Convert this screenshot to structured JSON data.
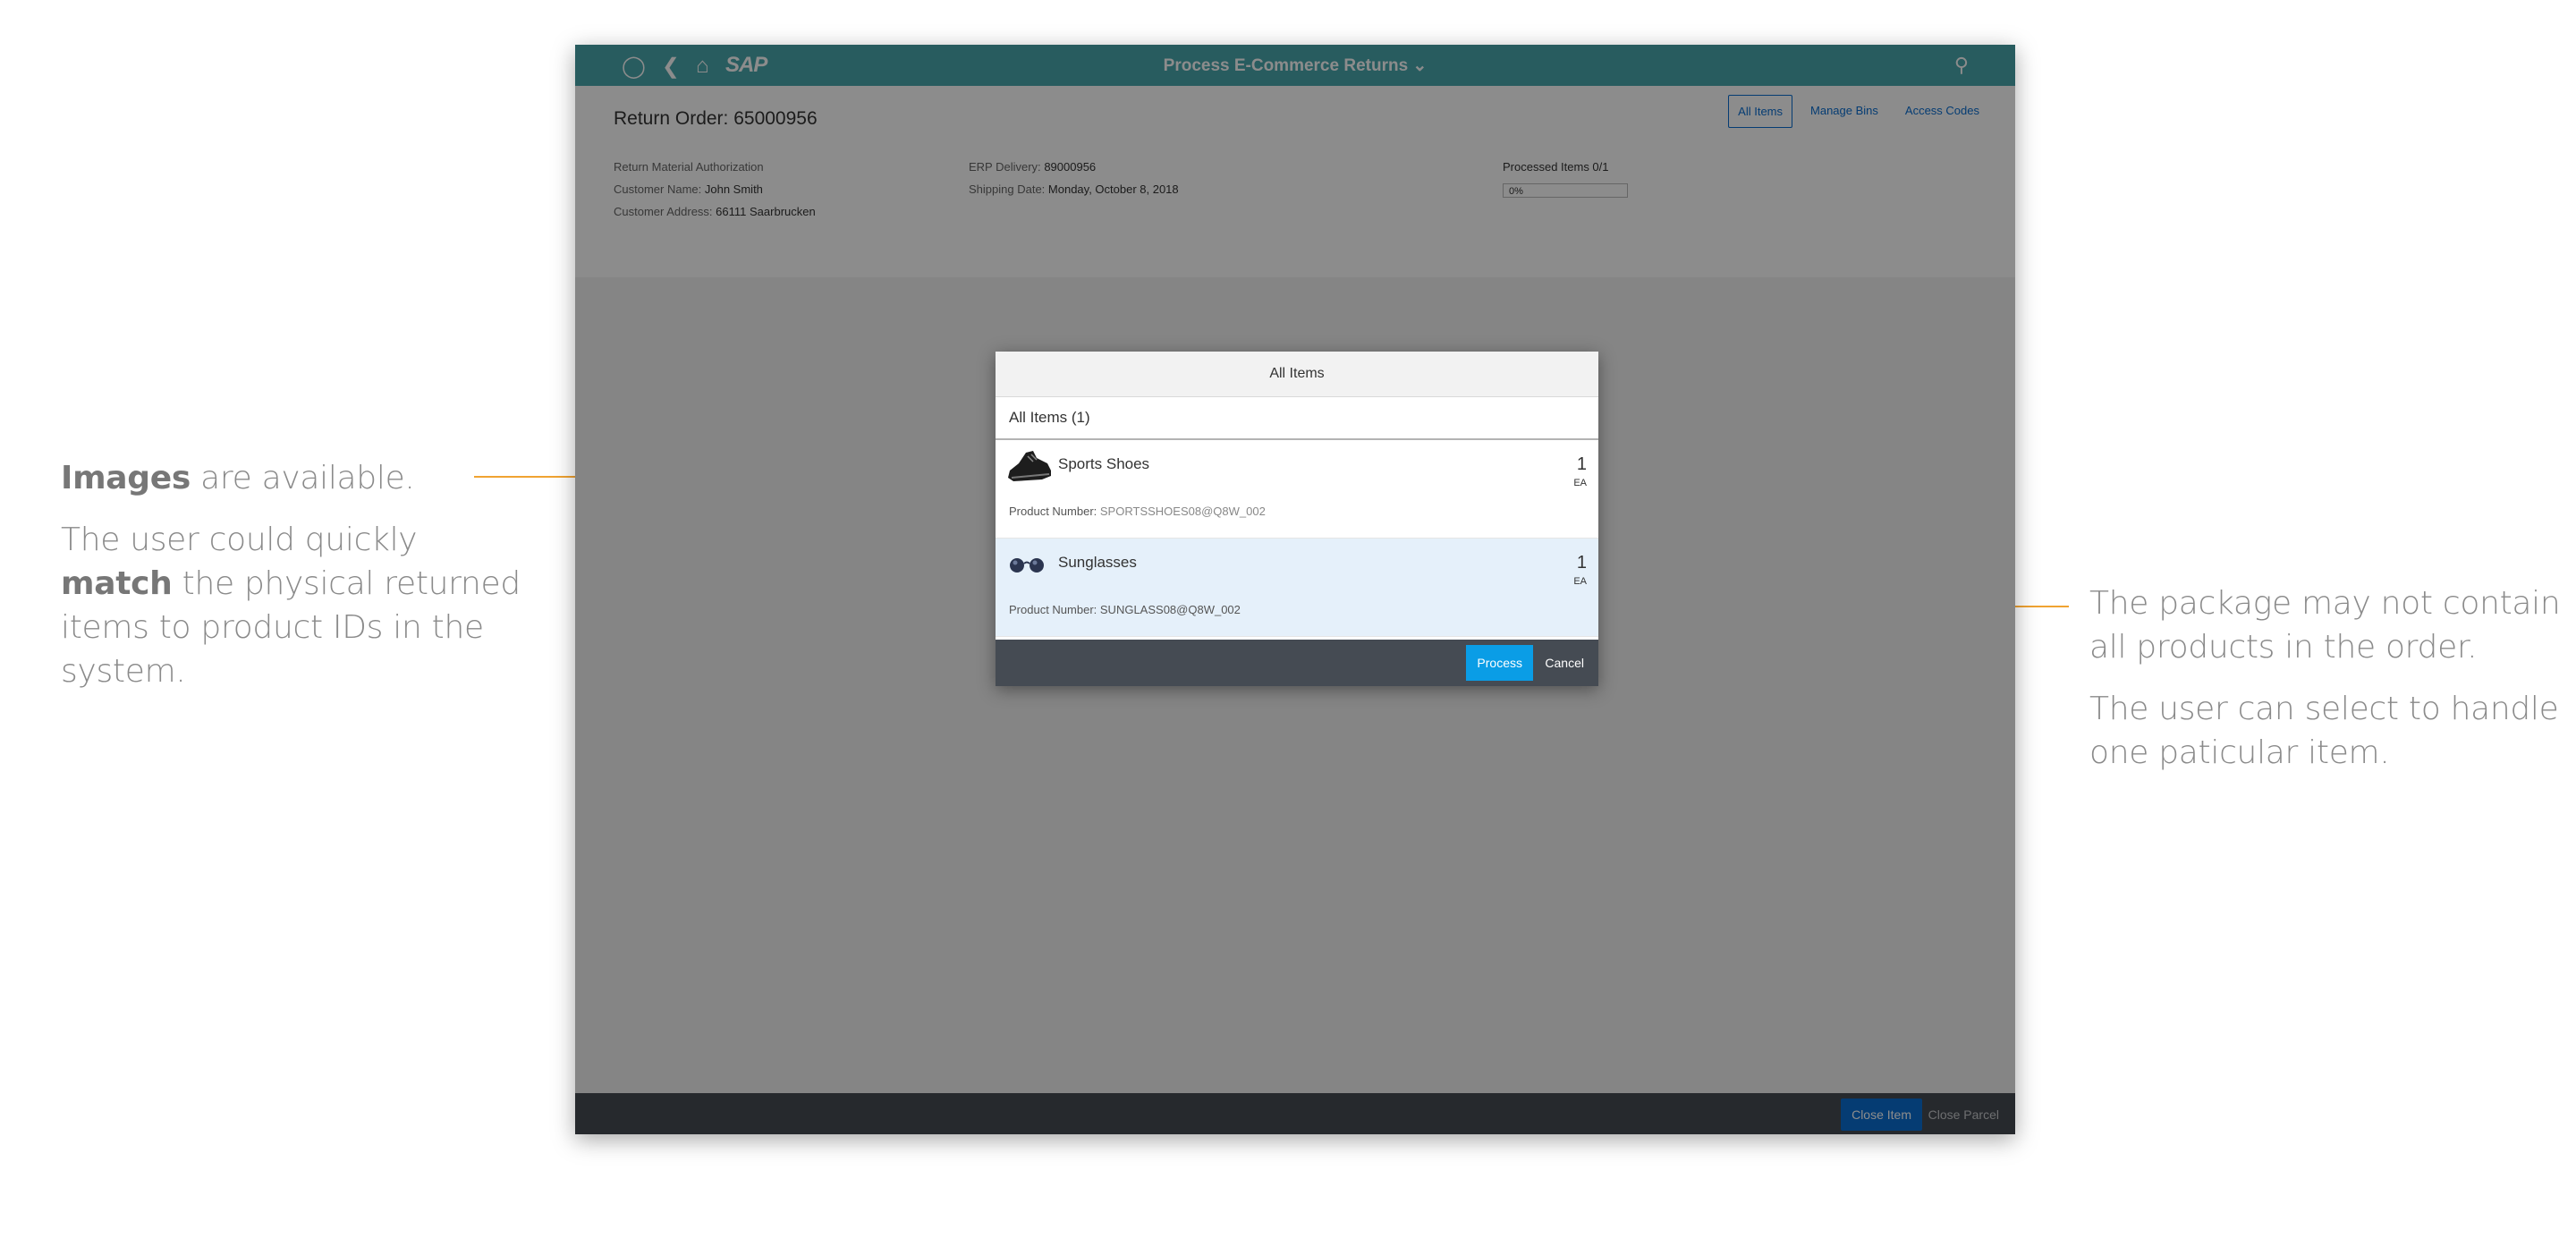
{
  "annotations": {
    "left": {
      "p1_bold": "Images",
      "p1_rest": " are available.",
      "p2_start": "The user could quickly ",
      "p2_bold": "match",
      "p2_rest": " the physical returned items to product IDs in the system."
    },
    "right": {
      "p1": "The package may not contain all products in the order.",
      "p2": "The user can select to handle one paticular item."
    },
    "accent_color": "#f0a332"
  },
  "shell": {
    "logo": "SAP",
    "title": "Process E-Commerce Returns ⌄",
    "icons": [
      "user-icon",
      "back-icon",
      "home-icon",
      "search-icon"
    ],
    "bar_color": "#4aa8ad"
  },
  "header": {
    "order_title": "Return Order: 65000956",
    "tabs": [
      "All Items",
      "Manage Bins",
      "Access Codes"
    ],
    "info_col1": {
      "rma_label": "Return Material Authorization",
      "customer_name_label": "Customer Name:",
      "customer_name": "John Smith",
      "customer_address_label": "Customer Address:",
      "customer_address": "66111 Saarbrucken"
    },
    "info_col2": {
      "erp_delivery_label": "ERP Delivery:",
      "erp_delivery": "89000956",
      "shipping_date_label": "Shipping Date:",
      "shipping_date": "Monday, October 8, 2018"
    },
    "processed_items": "Processed Items 0/1",
    "progress_text": "0%",
    "progress_value": 0
  },
  "footer": {
    "close_item": "Close Item",
    "close_parcel": "Close Parcel"
  },
  "dialog": {
    "title": "All Items",
    "list_header": "All Items (1)",
    "items": [
      {
        "name": "Sports Shoes",
        "qty": "1",
        "unit": "EA",
        "pn_label": "Product Number:",
        "pn": "SPORTSSHOES08@Q8W_002",
        "icon": "shoe-icon"
      },
      {
        "name": "Sunglasses",
        "qty": "1",
        "unit": "EA",
        "pn_label": "Product Number:",
        "pn": "SUNGLASS08@Q8W_002",
        "icon": "sunglasses-icon"
      }
    ],
    "process_button": "Process",
    "cancel_button": "Cancel"
  }
}
